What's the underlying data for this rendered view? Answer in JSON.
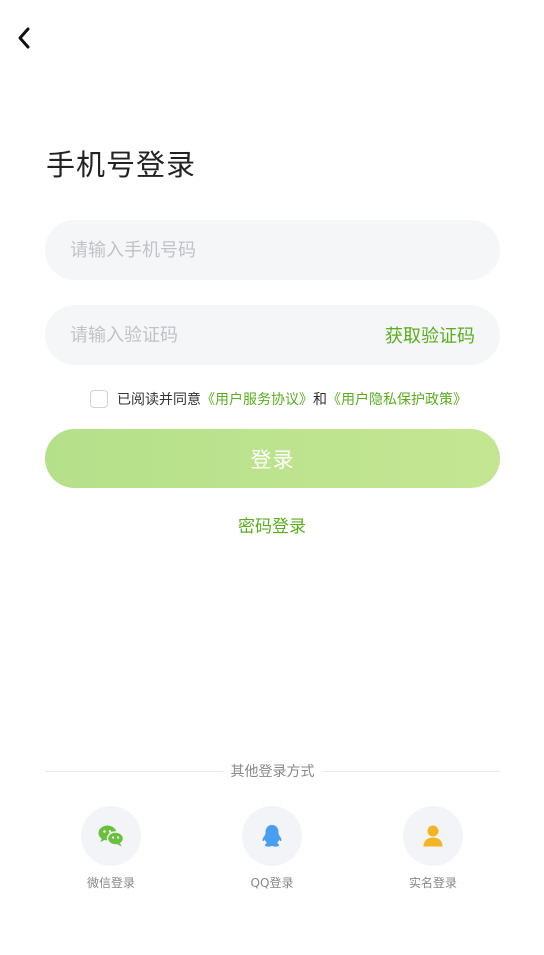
{
  "header": {
    "back_icon": "chevron-left-icon"
  },
  "title": "手机号登录",
  "phone": {
    "placeholder": "请输入手机号码",
    "value": ""
  },
  "code": {
    "placeholder": "请输入验证码",
    "value": "",
    "get_code_label": "获取验证码"
  },
  "agreement": {
    "checked": false,
    "prefix": "已阅读并同意",
    "terms_label": "《用户服务协议》",
    "conjunction": "和",
    "privacy_label": "《用户隐私保护政策》"
  },
  "login_button_label": "登录",
  "password_login_label": "密码登录",
  "other_methods": {
    "title": "其他登录方式",
    "items": [
      {
        "label": "微信登录",
        "icon": "wechat-icon",
        "color": "#6ac03c"
      },
      {
        "label": "QQ登录",
        "icon": "qq-icon",
        "color": "#4a9ef0"
      },
      {
        "label": "实名登录",
        "icon": "person-icon",
        "color": "#f5b423"
      }
    ]
  },
  "colors": {
    "accent": "#5aae1e",
    "button_bg": "#bde48e",
    "input_bg": "#f5f6f8"
  }
}
